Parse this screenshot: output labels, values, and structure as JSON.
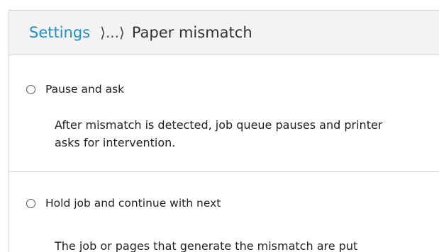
{
  "breadcrumb": {
    "root": "Settings",
    "separator": "⟩...⟩",
    "current": "Paper mismatch"
  },
  "options": [
    {
      "label": "Pause and ask",
      "description": "After mismatch is detected, job queue pauses and printer asks for intervention.",
      "selected": false
    },
    {
      "label": "Hold job and continue with next",
      "description": "The job or pages that generate the mismatch are put",
      "selected": false
    }
  ],
  "colors": {
    "link": "#1e8fc4",
    "header_bg": "#f3f3f3",
    "divider": "#dcdcdc"
  }
}
